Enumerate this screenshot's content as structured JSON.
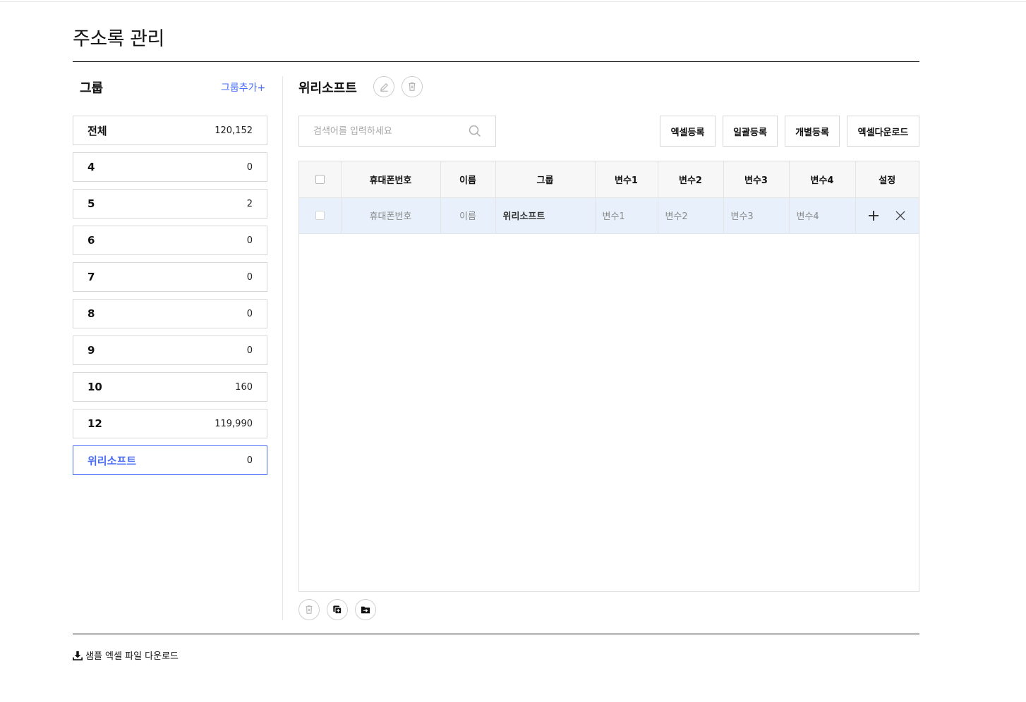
{
  "page": {
    "title": "주소록 관리"
  },
  "groups": {
    "heading": "그룹",
    "add_label": "그룹추가+",
    "items": [
      {
        "name": "전체",
        "count": "120,152"
      },
      {
        "name": "4",
        "count": "0"
      },
      {
        "name": "5",
        "count": "2"
      },
      {
        "name": "6",
        "count": "0"
      },
      {
        "name": "7",
        "count": "0"
      },
      {
        "name": "8",
        "count": "0"
      },
      {
        "name": "9",
        "count": "0"
      },
      {
        "name": "10",
        "count": "160"
      },
      {
        "name": "12",
        "count": "119,990"
      },
      {
        "name": "위리소프트",
        "count": "0"
      }
    ],
    "active_index": 9
  },
  "selected_group": {
    "title": "위리소프트"
  },
  "search": {
    "placeholder": "검색어를 입력하세요",
    "value": ""
  },
  "actions": {
    "excel_register": "엑셀등록",
    "bulk_register": "일괄등록",
    "individual_register": "개별등록",
    "excel_download": "엑셀다운로드"
  },
  "table": {
    "headers": [
      "휴대폰번호",
      "이름",
      "그룹",
      "변수1",
      "변수2",
      "변수3",
      "변수4",
      "설정"
    ],
    "input_row": {
      "phone": "휴대폰번호",
      "name": "이름",
      "group": "위리소프트",
      "var1": "변수1",
      "var2": "변수2",
      "var3": "변수3",
      "var4": "변수4"
    }
  },
  "footer": {
    "sample_download": "샘플 엑셀 파일 다운로드"
  },
  "colors": {
    "accent": "#4a6cf7",
    "row_highlight": "#e8f1fb"
  },
  "icons": {
    "edit": "pencil-icon",
    "delete": "trash-x-icon",
    "search": "search-icon",
    "add": "plus-icon",
    "close": "close-icon",
    "copy": "copy-icon",
    "move": "folder-move-icon",
    "download": "download-icon"
  }
}
